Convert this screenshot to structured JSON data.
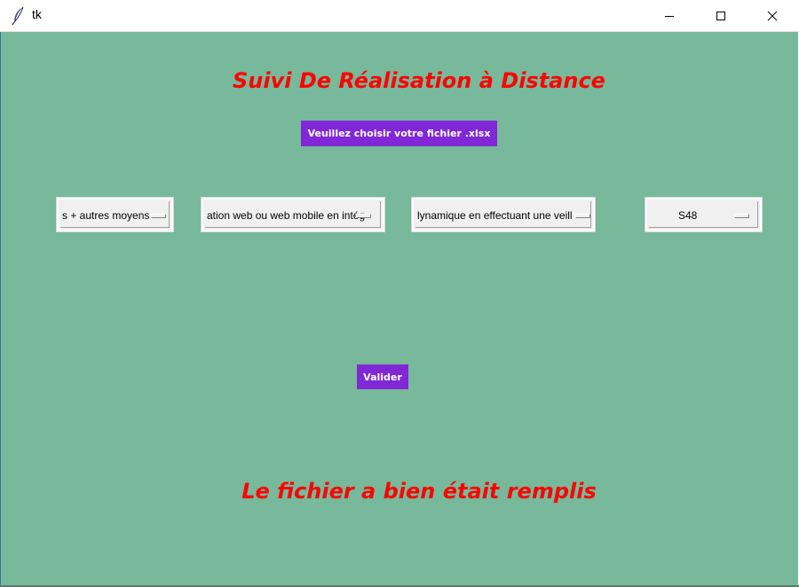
{
  "window": {
    "title": "tk",
    "icon": "feather-icon"
  },
  "main": {
    "heading": "Suivi De Réalisation à Distance",
    "choose_file_button": "Veuillez choisir votre fichier .xlsx",
    "option_menus": [
      {
        "selected": "s + autres moyens"
      },
      {
        "selected": "ation web ou web mobile en intég"
      },
      {
        "selected": "lynamique en effectuant une veill"
      },
      {
        "selected": "S48"
      }
    ],
    "validate_button": "Valider",
    "status_message": "Le fichier a bien était remplis"
  },
  "colors": {
    "background": "#77b99a",
    "heading": "#ff0000",
    "button": "#8128d6"
  }
}
